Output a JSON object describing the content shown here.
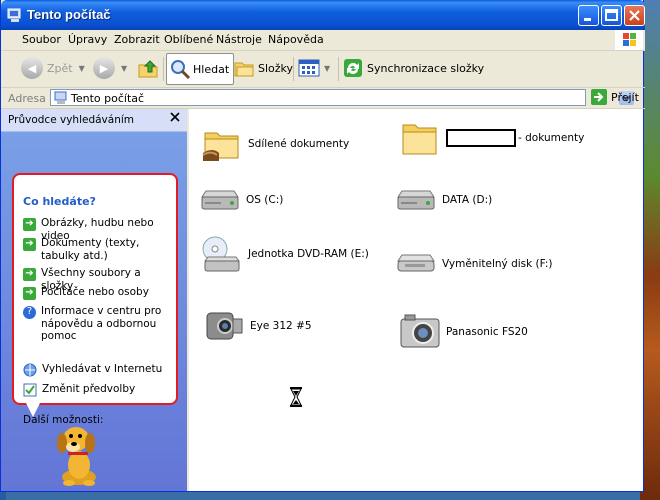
{
  "window": {
    "title": "Tento počítač"
  },
  "menu": [
    "Soubor",
    "Úpravy",
    "Zobrazit",
    "Oblíbené",
    "Nástroje",
    "Nápověda"
  ],
  "toolbar": {
    "back": "Zpět",
    "search": "Hledat",
    "folders": "Složky",
    "sync": "Synchronizace složky"
  },
  "address": {
    "label": "Adresa",
    "value": "Tento počítač",
    "go": "Přejít"
  },
  "left_pane": {
    "title": "Průvodce vyhledáváním",
    "question": "Co hledáte?",
    "options": [
      "Obrázky, hudbu nebo video",
      "Dokumenty (texty, tabulky atd.)",
      "Všechny soubory a složky",
      "Počítače nebo osoby",
      "Informace v centru pro nápovědu a odbornou pomoc"
    ],
    "more_label": "Další možnosti:",
    "more": [
      "Vyhledávat v Internetu",
      "Změnit předvolby"
    ]
  },
  "items": {
    "shared_docs": "Sdílené dokumenty",
    "user_docs_suffix": "- dokumenty",
    "drive_c": "OS (C:)",
    "drive_d": "DATA (D:)",
    "dvd": "Jednotka DVD-RAM (E:)",
    "removable": "Vyměnitelný disk (F:)",
    "camera1": "Eye 312 #5",
    "camera2": "Panasonic FS20"
  },
  "colors": {
    "title_blue": "#0a4fd0",
    "highlight_red": "#e41b24",
    "task_pane": "#6375d6"
  }
}
